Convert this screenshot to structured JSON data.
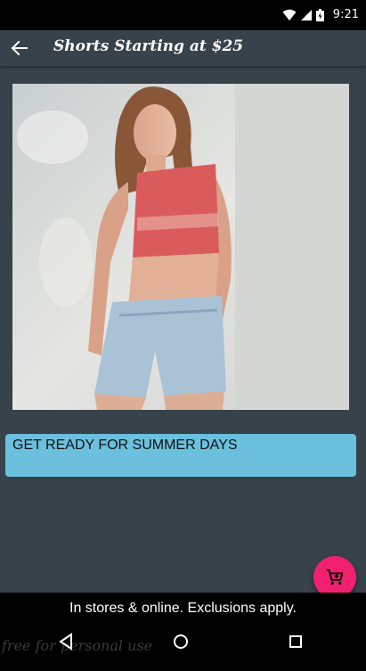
{
  "status_bar": {
    "time": "9:21",
    "icons": [
      "wifi-icon",
      "cell-signal-icon",
      "battery-icon"
    ]
  },
  "app_bar": {
    "back_icon": "arrow-left-icon",
    "title": "Shorts Starting at $25"
  },
  "hero_image": {
    "description_icon": "product-photo"
  },
  "promo": {
    "text": "GET READY FOR SUMMER DAYS"
  },
  "fab": {
    "icon": "add-to-cart-icon"
  },
  "footer": {
    "disclaimer": "In stores & online. Exclusions apply.",
    "watermark": "free for personal use"
  },
  "nav": {
    "back": "nav-back-icon",
    "home": "nav-home-icon",
    "recents": "nav-recents-icon"
  },
  "colors": {
    "background": "#37424a",
    "promo_card": "#6bc0de",
    "fab": "#f0206e",
    "bars": "#000000"
  }
}
